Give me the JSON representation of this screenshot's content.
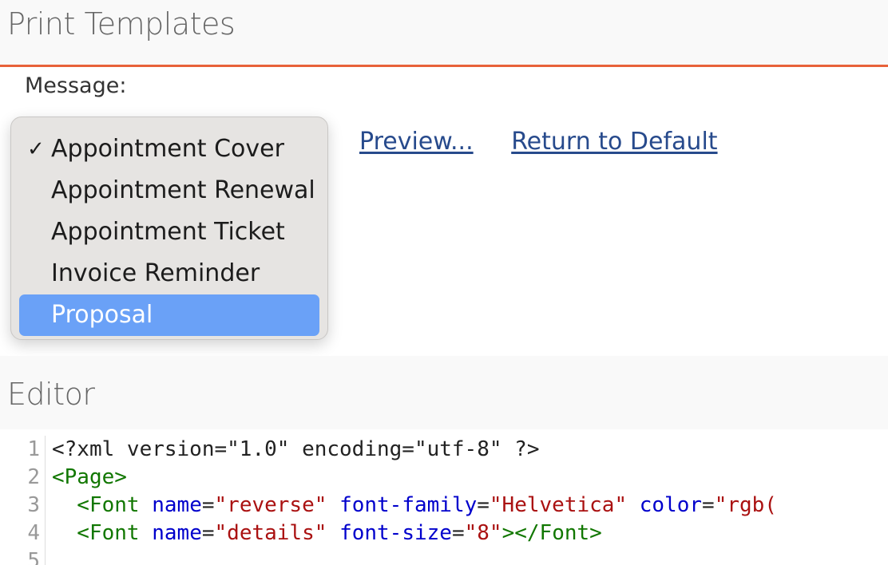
{
  "print_templates": {
    "title": "Print Templates",
    "message_label": "Message:",
    "preview_link": "Preview...",
    "return_default_link": "Return to Default",
    "options": [
      {
        "label": "Appointment Cover",
        "checked": true,
        "highlighted": false
      },
      {
        "label": "Appointment Renewal",
        "checked": false,
        "highlighted": false
      },
      {
        "label": "Appointment Ticket",
        "checked": false,
        "highlighted": false
      },
      {
        "label": "Invoice Reminder",
        "checked": false,
        "highlighted": false
      },
      {
        "label": "Proposal",
        "checked": false,
        "highlighted": true
      }
    ],
    "check_mark": "✓",
    "accent_color": "#e8623a",
    "highlight_color": "#6aa1f7"
  },
  "editor": {
    "title": "Editor",
    "lines": [
      {
        "num": "1",
        "tokens": [
          {
            "t": "plain",
            "v": "<?xml version=\"1.0\" encoding=\"utf-8\" ?>"
          }
        ]
      },
      {
        "num": "2",
        "tokens": [
          {
            "t": "tag",
            "v": "<Page>"
          }
        ]
      },
      {
        "num": "3",
        "tokens": [
          {
            "t": "tag",
            "v": "  <Font"
          },
          {
            "t": "plain",
            "v": " "
          },
          {
            "t": "attr",
            "v": "name"
          },
          {
            "t": "plain",
            "v": "="
          },
          {
            "t": "str",
            "v": "\"reverse\""
          },
          {
            "t": "plain",
            "v": " "
          },
          {
            "t": "attr",
            "v": "font-family"
          },
          {
            "t": "plain",
            "v": "="
          },
          {
            "t": "str",
            "v": "\"Helvetica\""
          },
          {
            "t": "plain",
            "v": " "
          },
          {
            "t": "attr",
            "v": "color"
          },
          {
            "t": "plain",
            "v": "="
          },
          {
            "t": "str",
            "v": "\"rgb("
          }
        ]
      },
      {
        "num": "4",
        "tokens": [
          {
            "t": "tag",
            "v": "  <Font"
          },
          {
            "t": "plain",
            "v": " "
          },
          {
            "t": "attr",
            "v": "name"
          },
          {
            "t": "plain",
            "v": "="
          },
          {
            "t": "str",
            "v": "\"details\""
          },
          {
            "t": "plain",
            "v": " "
          },
          {
            "t": "attr",
            "v": "font-size"
          },
          {
            "t": "plain",
            "v": "="
          },
          {
            "t": "str",
            "v": "\"8\""
          },
          {
            "t": "tag",
            "v": "></Font>"
          }
        ]
      },
      {
        "num": "5",
        "tokens": []
      }
    ]
  }
}
